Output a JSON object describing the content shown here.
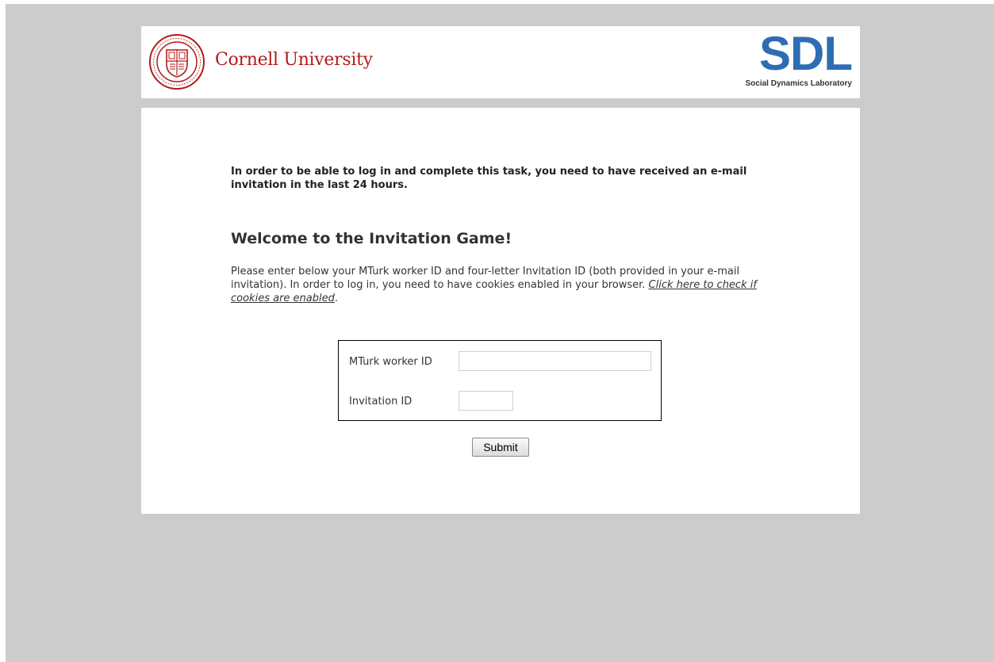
{
  "header": {
    "university_name": "Cornell University",
    "lab_logo_text": "SDL",
    "lab_name": "Social Dynamics Laboratory"
  },
  "notice": "In order to be able to log in and complete this task, you need to have received an e-mail invitation in the last 24 hours.",
  "welcome_title": "Welcome to the Invitation Game!",
  "intro": {
    "text": "Please enter below your MTurk worker ID and four-letter Invitation ID (both provided in your e-mail invitation). In order to log in, you need to have cookies enabled in your browser. ",
    "link_text": "Click here to check if cookies are enabled",
    "after_link": "."
  },
  "form": {
    "worker_label": "MTurk worker ID",
    "worker_value": "",
    "invitation_label": "Invitation ID",
    "invitation_value": "",
    "submit_label": "Submit"
  },
  "colors": {
    "background": "#cccccc",
    "cornell_red": "#b31b1b",
    "sdl_blue": "#2e6db3"
  }
}
